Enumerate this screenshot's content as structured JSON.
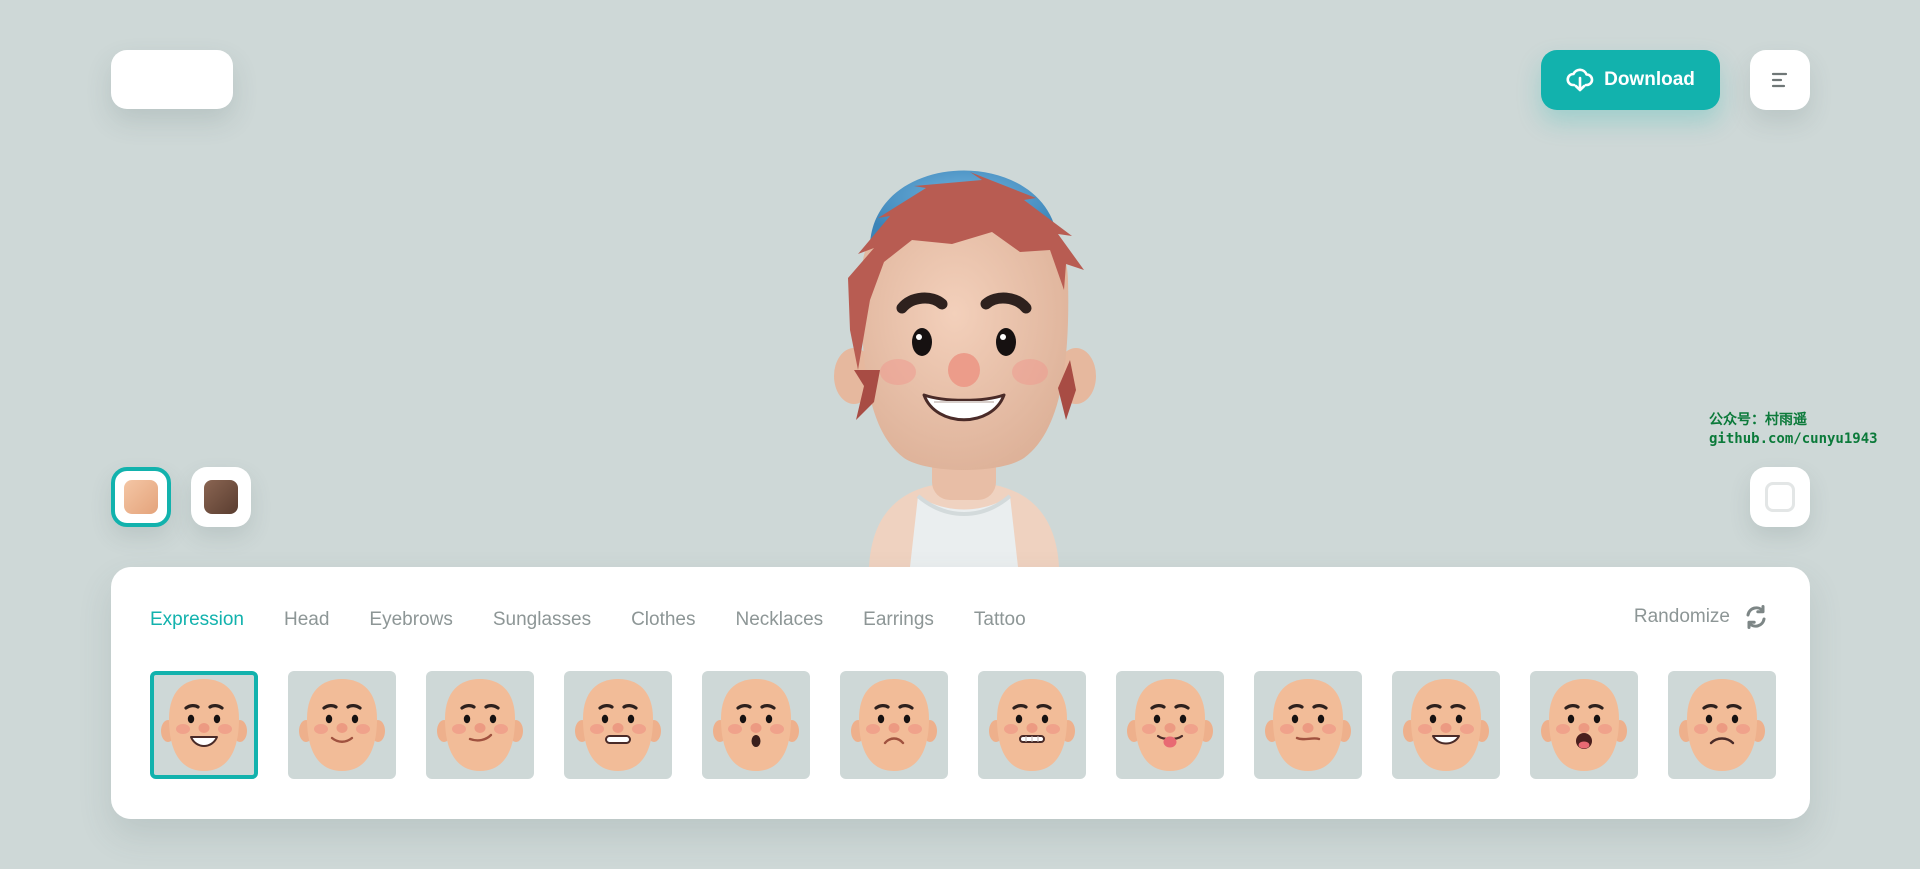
{
  "header": {
    "download_label": "Download",
    "download_icon": "cloud-download-icon",
    "menu_icon": "menu-lines-icon"
  },
  "colors": {
    "accent": "#12b2ad",
    "background": "#ced8d7",
    "skin_light": "#efb992",
    "skin_dark": "#6e4c3c"
  },
  "skin_tones": [
    {
      "name": "light",
      "selected": true
    },
    {
      "name": "dark",
      "selected": false
    }
  ],
  "watermark": {
    "line1": "公众号：村雨遥",
    "line2": "github.com/cunyu1943"
  },
  "tabs": [
    {
      "label": "Expression",
      "active": true
    },
    {
      "label": "Head",
      "active": false
    },
    {
      "label": "Eyebrows",
      "active": false
    },
    {
      "label": "Sunglasses",
      "active": false
    },
    {
      "label": "Clothes",
      "active": false
    },
    {
      "label": "Necklaces",
      "active": false
    },
    {
      "label": "Earrings",
      "active": false
    },
    {
      "label": "Tattoo",
      "active": false
    }
  ],
  "randomize": {
    "label": "Randomize",
    "icon": "refresh-icon"
  },
  "expressions": [
    {
      "name": "big-smile",
      "selected": true
    },
    {
      "name": "gentle-smile",
      "selected": false
    },
    {
      "name": "smirk",
      "selected": false
    },
    {
      "name": "grimace",
      "selected": false
    },
    {
      "name": "surprised",
      "selected": false
    },
    {
      "name": "sad",
      "selected": false
    },
    {
      "name": "teeth-clenched",
      "selected": false
    },
    {
      "name": "tongue-out",
      "selected": false
    },
    {
      "name": "wry",
      "selected": false
    },
    {
      "name": "grin",
      "selected": false
    },
    {
      "name": "shouting",
      "selected": false
    },
    {
      "name": "frown",
      "selected": false
    }
  ]
}
